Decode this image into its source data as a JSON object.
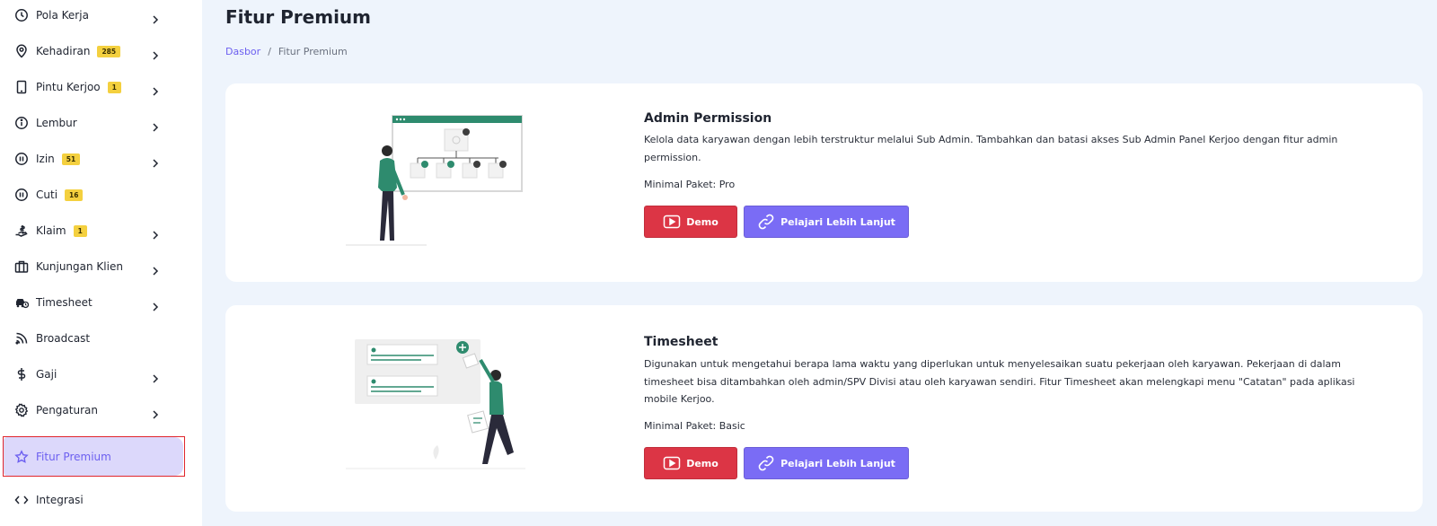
{
  "sidebar": {
    "items": [
      {
        "label": "Pola Kerja",
        "badge": "",
        "icon": "clock-icon",
        "chevron": true
      },
      {
        "label": "Kehadiran",
        "badge": "285",
        "icon": "location-pin-icon",
        "chevron": true
      },
      {
        "label": "Pintu Kerjoo",
        "badge": "1",
        "icon": "tablet-icon",
        "chevron": true
      },
      {
        "label": "Lembur",
        "badge": "",
        "icon": "info-circle-icon",
        "chevron": true
      },
      {
        "label": "Izin",
        "badge": "51",
        "icon": "pause-circle-icon",
        "chevron": true
      },
      {
        "label": "Cuti",
        "badge": "16",
        "icon": "pause-circle-icon",
        "chevron": false
      },
      {
        "label": "Klaim",
        "badge": "1",
        "icon": "hand-money-icon",
        "chevron": true
      },
      {
        "label": "Kunjungan Klien",
        "badge": "",
        "icon": "briefcase-icon",
        "chevron": true
      },
      {
        "label": "Timesheet",
        "badge": "",
        "icon": "car-clock-icon",
        "chevron": true
      },
      {
        "label": "Broadcast",
        "badge": "",
        "icon": "rss-icon",
        "chevron": false
      },
      {
        "label": "Gaji",
        "badge": "",
        "icon": "dollar-icon",
        "chevron": true
      },
      {
        "label": "Pengaturan",
        "badge": "",
        "icon": "gear-icon",
        "chevron": true
      },
      {
        "label": "Fitur Premium",
        "badge": "",
        "icon": "star-icon",
        "chevron": false,
        "active": true
      },
      {
        "label": "Integrasi",
        "badge": "",
        "icon": "code-icon",
        "chevron": false
      }
    ]
  },
  "header": {
    "title": "Fitur Premium",
    "breadcrumb": {
      "home": "Dasbor",
      "separator": "/",
      "current": "Fitur Premium"
    }
  },
  "features": [
    {
      "title": "Admin Permission",
      "description": "Kelola data karyawan dengan lebih terstruktur melalui Sub Admin. Tambahkan dan batasi akses Sub Admin Panel Kerjoo dengan fitur admin permission.",
      "min_package": "Minimal Paket: Pro",
      "demo_label": "Demo",
      "learn_label": "Pelajari Lebih Lanjut"
    },
    {
      "title": "Timesheet",
      "description": "Digunakan untuk mengetahui berapa lama waktu yang diperlukan untuk menyelesaikan suatu pekerjaan oleh karyawan. Pekerjaan di dalam timesheet bisa ditambahkan oleh admin/SPV Divisi atau oleh karyawan sendiri. Fitur Timesheet akan melengkapi menu \"Catatan\" pada aplikasi mobile Kerjoo.",
      "min_package": "Minimal Paket: Basic",
      "demo_label": "Demo",
      "learn_label": "Pelajari Lebih Lanjut"
    }
  ],
  "colors": {
    "accent": "#6c5ff0",
    "demo_button": "#dc3545",
    "learn_button": "#7a6cf5",
    "badge": "#f4d03f",
    "illustration_green": "#2e8b6e",
    "active_bg": "#dcd8fb"
  }
}
